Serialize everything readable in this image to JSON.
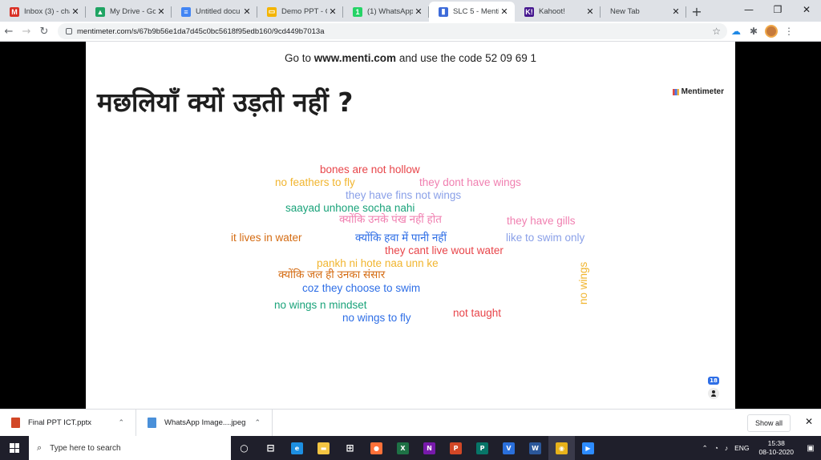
{
  "browser": {
    "tabs": [
      {
        "title": "Inbox (3) - cha",
        "icon": "gmail-icon",
        "color": "#d93025",
        "glyph": "M",
        "active": false
      },
      {
        "title": "My Drive - Go",
        "icon": "drive-icon",
        "color": "#1fa463",
        "glyph": "▲",
        "active": false
      },
      {
        "title": "Untitled docu",
        "icon": "docs-icon",
        "color": "#4285f4",
        "glyph": "≡",
        "active": false
      },
      {
        "title": "Demo PPT - G",
        "icon": "slides-icon",
        "color": "#f4b400",
        "glyph": "▭",
        "active": false
      },
      {
        "title": "(1) WhatsApp",
        "icon": "whatsapp-icon",
        "color": "#25d366",
        "glyph": "1",
        "active": false
      },
      {
        "title": "SLC 5 - Mentir",
        "icon": "mentimeter-icon",
        "color": "#3d6bd9",
        "glyph": "▮",
        "active": true
      },
      {
        "title": "Kahoot!",
        "icon": "kahoot-icon",
        "color": "#46178f",
        "glyph": "K!",
        "active": false
      },
      {
        "title": "New Tab",
        "icon": "",
        "color": "",
        "glyph": "",
        "active": false
      }
    ],
    "url": "mentimeter.com/s/67b9b56e1da7d45c0bc5618f95edb160/9cd449b7013a"
  },
  "slide": {
    "instructions_prefix": "Go to ",
    "instructions_site": "www.menti.com",
    "instructions_middle": " and use the code ",
    "instructions_code": "52 09 69 1",
    "question": "मछलियाँ क्यों उड़ती नहीं ?",
    "brand": "Mentimeter",
    "response_count": "18",
    "words": [
      {
        "text": "bones are not hollow",
        "color": "#e8454a"
      },
      {
        "text": "no feathers to fly",
        "color": "#f1b52f"
      },
      {
        "text": "they dont have wings",
        "color": "#f07fb0"
      },
      {
        "text": "they have fins not wings",
        "color": "#8aa0e8"
      },
      {
        "text": "saayad unhone socha nahi",
        "color": "#1aa37a"
      },
      {
        "text": "क्योंकि उनके पंख नहीं होत",
        "color": "#f07fb0"
      },
      {
        "text": "they have gills",
        "color": "#f07fb0"
      },
      {
        "text": "it lives in water",
        "color": "#d46b12"
      },
      {
        "text": "क्योंकि हवा में पानी नहीं",
        "color": "#2e6ee6"
      },
      {
        "text": "like to swim only",
        "color": "#8aa0e8"
      },
      {
        "text": "they cant live wout water",
        "color": "#e8454a"
      },
      {
        "text": "pankh ni hote naa unn ke",
        "color": "#f1b52f"
      },
      {
        "text": "क्योंकि जल ही उनका संसार",
        "color": "#d46b12"
      },
      {
        "text": "coz they choose to swim",
        "color": "#2e6ee6"
      },
      {
        "text": "no wings n mindset",
        "color": "#1aa37a"
      },
      {
        "text": "no wings to fly",
        "color": "#2e6ee6"
      },
      {
        "text": "not taught",
        "color": "#e8454a"
      },
      {
        "text": "no wings",
        "color": "#f1b52f"
      }
    ]
  },
  "downloads": {
    "items": [
      {
        "name": "Final PPT ICT.pptx",
        "color": "#d24726"
      },
      {
        "name": "WhatsApp Image....jpeg",
        "color": "#4a90d9"
      }
    ],
    "show_all": "Show all"
  },
  "taskbar": {
    "search_placeholder": "Type here to search",
    "language": "ENG",
    "time": "15:38",
    "date": "08-10-2020",
    "apps": [
      {
        "icon": "task-view-icon",
        "color": "#ffffff",
        "glyph": "○"
      },
      {
        "icon": "widgets-icon",
        "color": "#ffffff",
        "glyph": "⊟"
      },
      {
        "icon": "edge-icon",
        "color": "#1d8fe1",
        "glyph": "e"
      },
      {
        "icon": "file-explorer-icon",
        "color": "#f4c542",
        "glyph": "▬"
      },
      {
        "icon": "store-icon",
        "color": "#ffffff",
        "glyph": "⊞"
      },
      {
        "icon": "firefox-icon",
        "color": "#ff7139",
        "glyph": "●"
      },
      {
        "icon": "excel-icon",
        "color": "#1e7145",
        "glyph": "X"
      },
      {
        "icon": "onenote-icon",
        "color": "#7719aa",
        "glyph": "N"
      },
      {
        "icon": "powerpoint-icon",
        "color": "#d24726",
        "glyph": "P"
      },
      {
        "icon": "publisher-icon",
        "color": "#077568",
        "glyph": "P"
      },
      {
        "icon": "vpn-icon",
        "color": "#2a6fdb",
        "glyph": "V"
      },
      {
        "icon": "word-icon",
        "color": "#2b579a",
        "glyph": "W"
      },
      {
        "icon": "chrome-icon",
        "color": "#e8b21a",
        "glyph": "◉"
      },
      {
        "icon": "zoom-icon",
        "color": "#2d8cff",
        "glyph": "▶"
      }
    ]
  }
}
